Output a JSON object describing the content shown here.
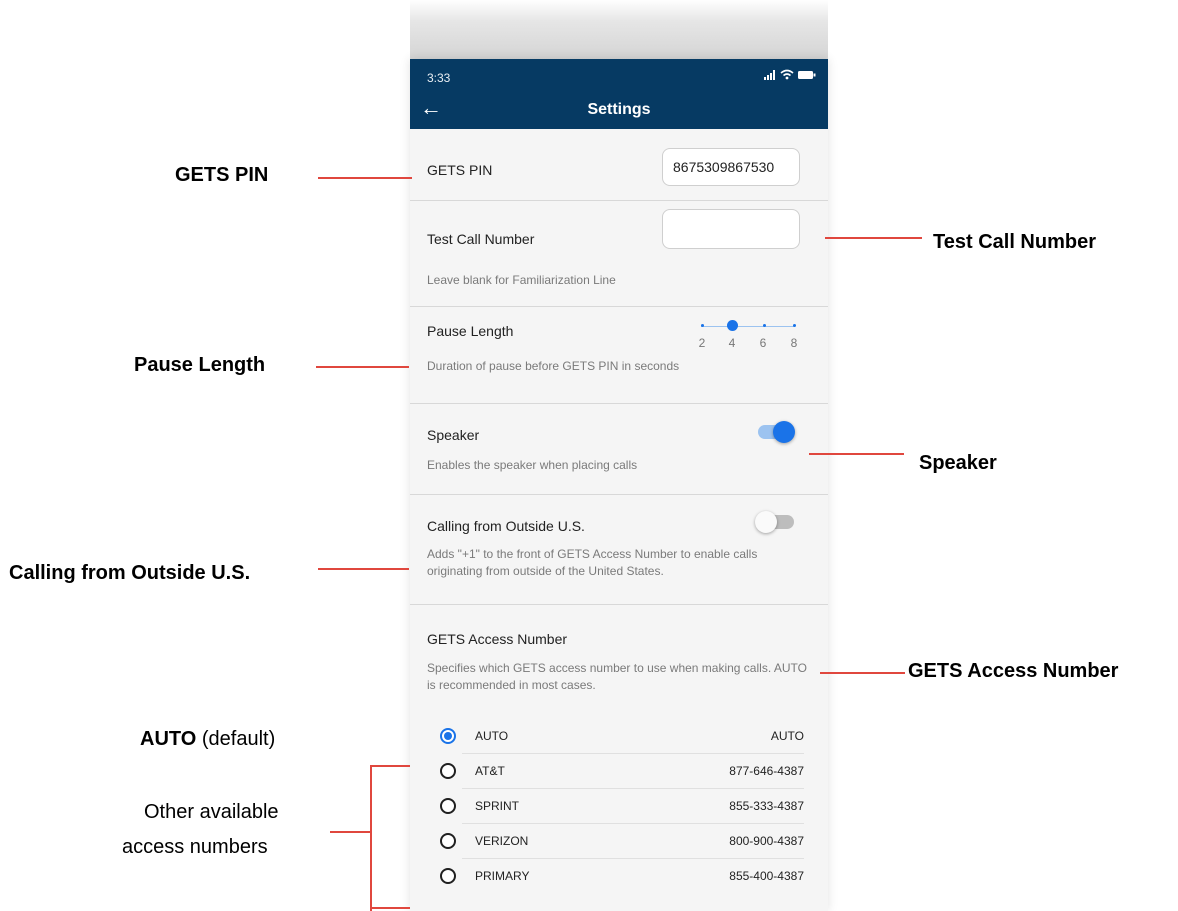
{
  "status_bar": {
    "time": "3:33"
  },
  "header": {
    "title": "Settings"
  },
  "gets_pin": {
    "label": "GETS PIN",
    "value": "8675309867530"
  },
  "test_call": {
    "label": "Test Call Number",
    "value": "",
    "description": "Leave blank for Familiarization Line"
  },
  "pause_length": {
    "label": "Pause Length",
    "description": "Duration of pause before GETS PIN in seconds",
    "ticks": [
      "2",
      "4",
      "6",
      "8"
    ],
    "selected": 4
  },
  "speaker": {
    "label": "Speaker",
    "description": "Enables the speaker when placing calls",
    "enabled": true
  },
  "outside_us": {
    "label": "Calling from Outside U.S.",
    "description": "Adds \"+1\" to the front of GETS Access Number to enable calls originating from outside of the United States.",
    "enabled": false
  },
  "access_number": {
    "label": "GETS Access Number",
    "description": "Specifies which GETS access number to use when making calls. AUTO is recommended in most cases.",
    "options": [
      {
        "name": "AUTO",
        "value": "AUTO",
        "selected": true
      },
      {
        "name": "AT&T",
        "value": "877-646-4387",
        "selected": false
      },
      {
        "name": "SPRINT",
        "value": "855-333-4387",
        "selected": false
      },
      {
        "name": "VERIZON",
        "value": "800-900-4387",
        "selected": false
      },
      {
        "name": "PRIMARY",
        "value": "855-400-4387",
        "selected": false
      }
    ]
  },
  "annotations": {
    "gets_pin": "GETS PIN",
    "test_call": "Test Call Number",
    "pause_length": "Pause Length",
    "speaker": "Speaker",
    "outside_us": "Calling from Outside U.S.",
    "access_number": "GETS Access Number",
    "auto_bold": "AUTO",
    "auto_suffix": "(default)",
    "other_line1": "Other available",
    "other_line2": "access numbers"
  },
  "colors": {
    "header_bg": "#063a63",
    "accent": "#1a73e8",
    "callout_line": "#e0473e"
  }
}
